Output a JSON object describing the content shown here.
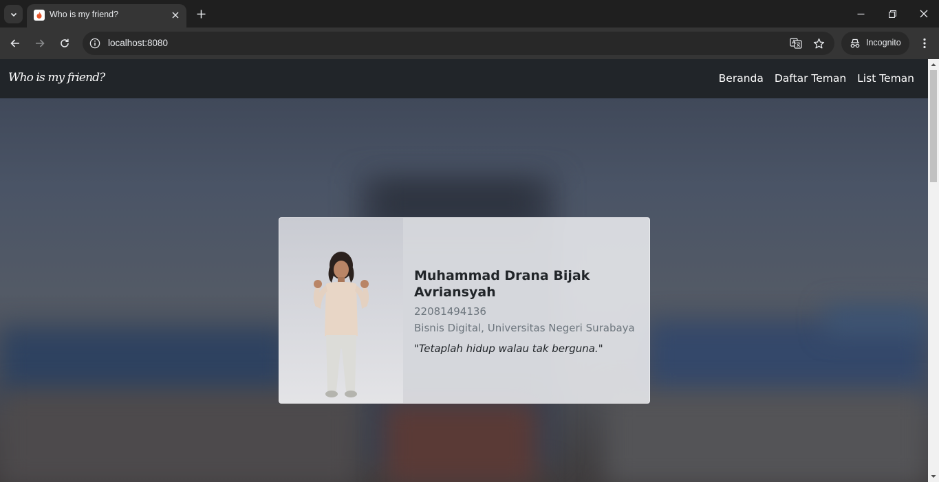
{
  "browser": {
    "tab_title": "Who is my friend?",
    "url": "localhost:8080",
    "incognito_label": "Incognito"
  },
  "navbar": {
    "brand": "Who is my friend?",
    "links": [
      "Beranda",
      "Daftar Teman",
      "List Teman"
    ]
  },
  "profile": {
    "name": "Muhammad Drana Bijak Avriansyah",
    "nim": "22081494136",
    "program": "Bisnis Digital, Universitas Negeri Surabaya",
    "quote": "\"Tetaplah hidup walau tak berguna.\""
  },
  "colors": {
    "navbar_bg": "#212529",
    "browser_tabbar": "#1f1f1f",
    "browser_toolbar": "#353535"
  }
}
